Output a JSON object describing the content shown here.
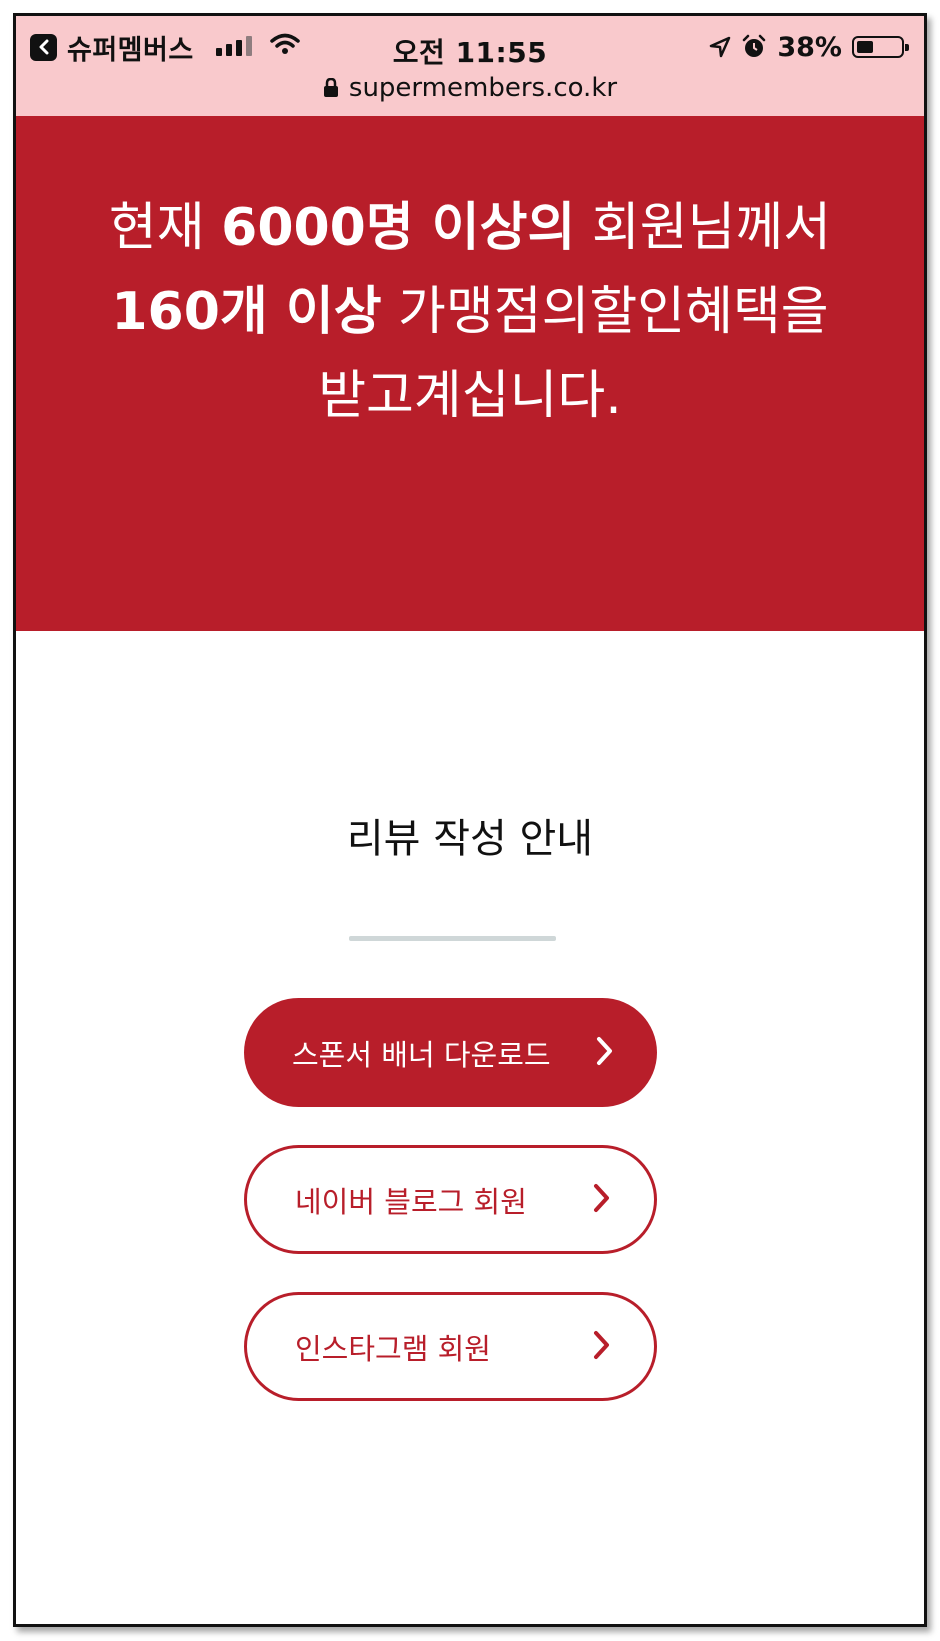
{
  "status_bar": {
    "back_app": "슈퍼멤버스",
    "time": "오전 11:55",
    "battery_percent": "38%",
    "battery_level": 0.38,
    "icons": [
      "back-icon",
      "signal-icon",
      "wifi-icon",
      "location-icon",
      "alarm-icon",
      "battery-icon"
    ]
  },
  "url_bar": {
    "url": "supermembers.co.kr",
    "icon": "lock-icon"
  },
  "hero": {
    "line1_pre": "현재 ",
    "line1_bold": "6000명 이상의",
    "line1_post": " 회원님께서",
    "line2_bold": "160개 이상",
    "line2_post": " 가맹점의할인혜택을",
    "line3": "받고계십니다.",
    "background": "#b81e2a"
  },
  "section": {
    "title": "리뷰 작성 안내"
  },
  "buttons": [
    {
      "label": "스폰서 배너 다운로드",
      "style": "filled"
    },
    {
      "label": "네이버 블로그 회원",
      "style": "outline"
    },
    {
      "label": "인스타그램 회원",
      "style": "outline"
    }
  ],
  "colors": {
    "accent": "#b81e2a",
    "status_bar": "#f9c9cc",
    "divider": "#cfd7d8"
  }
}
